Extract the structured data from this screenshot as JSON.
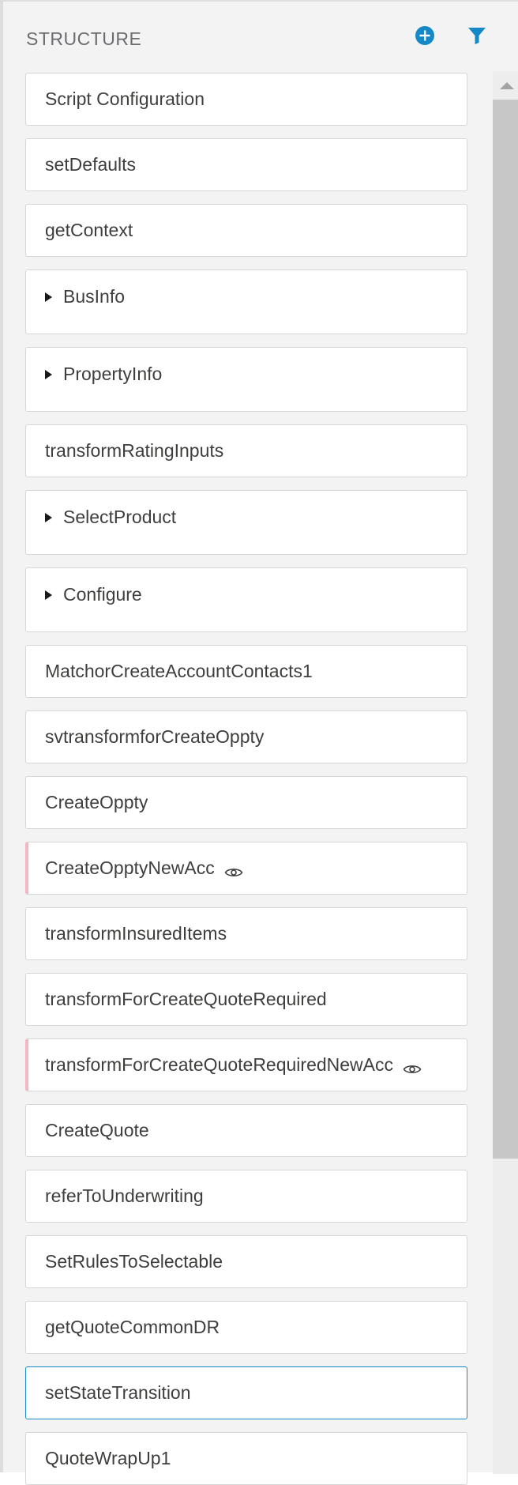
{
  "header": {
    "title": "STRUCTURE",
    "add_icon": "plus-circle-icon",
    "filter_icon": "filter-icon",
    "accent_color": "#1589c7"
  },
  "steps": [
    {
      "label": "Script Configuration"
    },
    {
      "label": "setDefaults"
    },
    {
      "label": "getContext"
    },
    {
      "label": "BusInfo",
      "expandable": true
    },
    {
      "label": "PropertyInfo",
      "expandable": true
    },
    {
      "label": "transformRatingInputs"
    },
    {
      "label": "SelectProduct",
      "expandable": true
    },
    {
      "label": "Configure",
      "expandable": true
    },
    {
      "label": "MatchorCreateAccountContacts1"
    },
    {
      "label": "svtransformforCreateOppty"
    },
    {
      "label": "CreateOppty"
    },
    {
      "label": "CreateOpptyNewAcc",
      "has_eye_icon": true,
      "inactive": true
    },
    {
      "label": "transformInsuredItems"
    },
    {
      "label": "transformForCreateQuoteRequired"
    },
    {
      "label": "transformForCreateQuoteRequiredNewAcc",
      "has_eye_icon": true,
      "inactive": true
    },
    {
      "label": "CreateQuote"
    },
    {
      "label": "referToUnderwriting"
    },
    {
      "label": "SetRulesToSelectable"
    },
    {
      "label": "getQuoteCommonDR"
    },
    {
      "label": "setStateTransition",
      "selected": true
    },
    {
      "label": "QuoteWrapUp1"
    }
  ]
}
